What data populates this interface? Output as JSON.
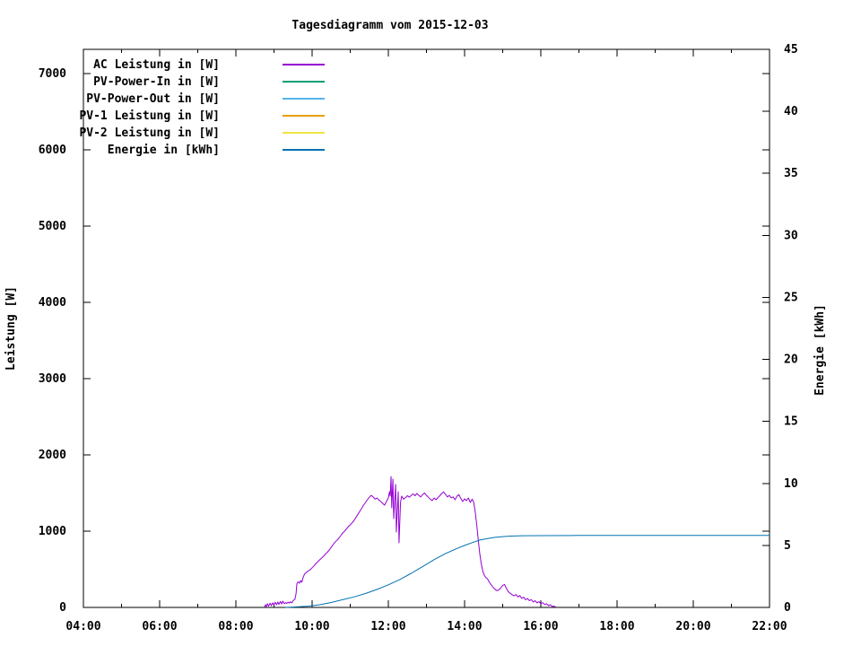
{
  "chart_data": {
    "type": "line",
    "title": "Tagesdiagramm vom 2015-12-03",
    "background_color": "#ffffff",
    "foreground_color": "#000000",
    "grid": false,
    "legend_position": "top-left-inside",
    "x_axis": {
      "unit": "time",
      "min_hour": 4,
      "max_hour": 22,
      "major_ticks": [
        {
          "hour": 4,
          "label": "04:00"
        },
        {
          "hour": 6,
          "label": "06:00"
        },
        {
          "hour": 8,
          "label": "08:00"
        },
        {
          "hour": 10,
          "label": "10:00"
        },
        {
          "hour": 12,
          "label": "12:00"
        },
        {
          "hour": 14,
          "label": "14:00"
        },
        {
          "hour": 16,
          "label": "16:00"
        },
        {
          "hour": 18,
          "label": "18:00"
        },
        {
          "hour": 20,
          "label": "20:00"
        },
        {
          "hour": 22,
          "label": "22:00"
        }
      ],
      "minor_tick_hours": [
        5,
        7,
        9,
        11,
        13,
        15,
        17,
        19,
        21
      ]
    },
    "y_axis_left": {
      "title": "Leistung [W]",
      "min": 0,
      "max": 7318,
      "tick_values": [
        0,
        1000,
        2000,
        3000,
        4000,
        5000,
        6000,
        7000
      ],
      "tick_labels": [
        "0",
        "1000",
        "2000",
        "3000",
        "4000",
        "5000",
        "6000",
        "7000"
      ]
    },
    "y_axis_right": {
      "title": "Energie [kWh]",
      "min": 0,
      "max": 45,
      "tick_values": [
        0,
        5,
        10,
        15,
        20,
        25,
        30,
        35,
        40,
        45
      ],
      "tick_labels": [
        "0",
        "5",
        "10",
        "15",
        "20",
        "25",
        "30",
        "35",
        "40",
        "45"
      ]
    },
    "series": [
      {
        "name": "AC Leistung in [W]",
        "color": "#9400d3",
        "axis": "left",
        "points": [
          [
            8.75,
            5
          ],
          [
            8.78,
            35
          ],
          [
            8.8,
            12
          ],
          [
            8.83,
            48
          ],
          [
            8.86,
            18
          ],
          [
            8.9,
            55
          ],
          [
            8.93,
            22
          ],
          [
            8.97,
            60
          ],
          [
            9.0,
            30
          ],
          [
            9.03,
            68
          ],
          [
            9.07,
            35
          ],
          [
            9.1,
            72
          ],
          [
            9.13,
            40
          ],
          [
            9.17,
            78
          ],
          [
            9.2,
            45
          ],
          [
            9.23,
            82
          ],
          [
            9.27,
            50
          ],
          [
            9.3,
            62
          ],
          [
            9.33,
            52
          ],
          [
            9.37,
            70
          ],
          [
            9.4,
            55
          ],
          [
            9.43,
            75
          ],
          [
            9.47,
            60
          ],
          [
            9.5,
            88
          ],
          [
            9.55,
            110
          ],
          [
            9.58,
            180
          ],
          [
            9.6,
            310
          ],
          [
            9.63,
            335
          ],
          [
            9.67,
            318
          ],
          [
            9.7,
            353
          ],
          [
            9.73,
            330
          ],
          [
            9.77,
            400
          ],
          [
            9.8,
            435
          ],
          [
            9.85,
            460
          ],
          [
            9.9,
            480
          ],
          [
            9.95,
            494
          ],
          [
            10.0,
            520
          ],
          [
            10.05,
            545
          ],
          [
            10.1,
            576
          ],
          [
            10.15,
            600
          ],
          [
            10.2,
            625
          ],
          [
            10.25,
            647
          ],
          [
            10.3,
            672
          ],
          [
            10.35,
            700
          ],
          [
            10.4,
            724
          ],
          [
            10.45,
            753
          ],
          [
            10.5,
            790
          ],
          [
            10.55,
            824
          ],
          [
            10.6,
            855
          ],
          [
            10.65,
            880
          ],
          [
            10.7,
            906
          ],
          [
            10.75,
            941
          ],
          [
            10.8,
            975
          ],
          [
            10.85,
            1000
          ],
          [
            10.9,
            1030
          ],
          [
            10.95,
            1060
          ],
          [
            11.0,
            1082
          ],
          [
            11.05,
            1110
          ],
          [
            11.1,
            1141
          ],
          [
            11.15,
            1180
          ],
          [
            11.2,
            1220
          ],
          [
            11.25,
            1259
          ],
          [
            11.3,
            1300
          ],
          [
            11.35,
            1341
          ],
          [
            11.4,
            1376
          ],
          [
            11.45,
            1412
          ],
          [
            11.5,
            1445
          ],
          [
            11.55,
            1470
          ],
          [
            11.6,
            1450
          ],
          [
            11.65,
            1420
          ],
          [
            11.7,
            1435
          ],
          [
            11.75,
            1410
          ],
          [
            11.8,
            1390
          ],
          [
            11.85,
            1365
          ],
          [
            11.9,
            1341
          ],
          [
            11.95,
            1390
          ],
          [
            12.0,
            1435
          ],
          [
            12.03,
            1518
          ],
          [
            12.05,
            1460
          ],
          [
            12.07,
            1717
          ],
          [
            12.09,
            1306
          ],
          [
            12.12,
            1682
          ],
          [
            12.14,
            1165
          ],
          [
            12.19,
            1612
          ],
          [
            12.21,
            988
          ],
          [
            12.26,
            1518
          ],
          [
            12.28,
            847
          ],
          [
            12.32,
            1380
          ],
          [
            12.35,
            1459
          ],
          [
            12.4,
            1420
          ],
          [
            12.45,
            1440
          ],
          [
            12.5,
            1465
          ],
          [
            12.55,
            1445
          ],
          [
            12.6,
            1470
          ],
          [
            12.65,
            1488
          ],
          [
            12.7,
            1465
          ],
          [
            12.75,
            1494
          ],
          [
            12.8,
            1470
          ],
          [
            12.85,
            1450
          ],
          [
            12.9,
            1480
          ],
          [
            12.95,
            1500
          ],
          [
            13.0,
            1470
          ],
          [
            13.05,
            1445
          ],
          [
            13.1,
            1420
          ],
          [
            13.15,
            1400
          ],
          [
            13.2,
            1435
          ],
          [
            13.25,
            1412
          ],
          [
            13.3,
            1440
          ],
          [
            13.35,
            1465
          ],
          [
            13.4,
            1494
          ],
          [
            13.45,
            1515
          ],
          [
            13.5,
            1480
          ],
          [
            13.55,
            1450
          ],
          [
            13.6,
            1470
          ],
          [
            13.65,
            1435
          ],
          [
            13.7,
            1450
          ],
          [
            13.75,
            1412
          ],
          [
            13.8,
            1459
          ],
          [
            13.85,
            1480
          ],
          [
            13.9,
            1430
          ],
          [
            13.95,
            1388
          ],
          [
            14.0,
            1424
          ],
          [
            14.05,
            1400
          ],
          [
            14.1,
            1435
          ],
          [
            14.15,
            1376
          ],
          [
            14.2,
            1420
          ],
          [
            14.24,
            1376
          ],
          [
            14.28,
            1250
          ],
          [
            14.32,
            1080
          ],
          [
            14.36,
            880
          ],
          [
            14.4,
            700
          ],
          [
            14.44,
            566
          ],
          [
            14.48,
            470
          ],
          [
            14.52,
            420
          ],
          [
            14.56,
            390
          ],
          [
            14.6,
            376
          ],
          [
            14.65,
            330
          ],
          [
            14.7,
            295
          ],
          [
            14.75,
            260
          ],
          [
            14.8,
            238
          ],
          [
            14.85,
            220
          ],
          [
            14.9,
            230
          ],
          [
            14.95,
            258
          ],
          [
            15.0,
            290
          ],
          [
            15.05,
            300
          ],
          [
            15.1,
            245
          ],
          [
            15.15,
            205
          ],
          [
            15.2,
            185
          ],
          [
            15.25,
            165
          ],
          [
            15.3,
            152
          ],
          [
            15.35,
            170
          ],
          [
            15.4,
            138
          ],
          [
            15.45,
            155
          ],
          [
            15.5,
            118
          ],
          [
            15.55,
            135
          ],
          [
            15.6,
            100
          ],
          [
            15.65,
            118
          ],
          [
            15.7,
            88
          ],
          [
            15.75,
            102
          ],
          [
            15.8,
            72
          ],
          [
            15.85,
            88
          ],
          [
            15.9,
            60
          ],
          [
            15.95,
            75
          ],
          [
            16.0,
            50
          ],
          [
            16.05,
            62
          ],
          [
            16.1,
            38
          ],
          [
            16.15,
            50
          ],
          [
            16.2,
            24
          ],
          [
            16.25,
            35
          ],
          [
            16.3,
            12
          ],
          [
            16.35,
            18
          ],
          [
            16.4,
            2
          ]
        ]
      },
      {
        "name": "PV-Power-In in [W]",
        "color": "#009e73",
        "axis": "left",
        "points": []
      },
      {
        "name": "PV-Power-Out in [W]",
        "color": "#56b4e9",
        "axis": "left",
        "points": []
      },
      {
        "name": "PV-1 Leistung in [W]",
        "color": "#e69f00",
        "axis": "left",
        "points": []
      },
      {
        "name": "PV-2 Leistung in [W]",
        "color": "#f0e442",
        "axis": "left",
        "points": []
      },
      {
        "name": "Energie in [kWh]",
        "color": "#0072b2",
        "axis": "right",
        "points": [
          [
            9.3,
            0
          ],
          [
            9.6,
            0.04
          ],
          [
            9.9,
            0.1
          ],
          [
            10.2,
            0.22
          ],
          [
            10.5,
            0.4
          ],
          [
            10.8,
            0.62
          ],
          [
            11.1,
            0.85
          ],
          [
            11.4,
            1.12
          ],
          [
            11.7,
            1.45
          ],
          [
            12.0,
            1.82
          ],
          [
            12.3,
            2.25
          ],
          [
            12.6,
            2.75
          ],
          [
            12.9,
            3.3
          ],
          [
            13.2,
            3.85
          ],
          [
            13.5,
            4.35
          ],
          [
            13.8,
            4.75
          ],
          [
            14.0,
            5.0
          ],
          [
            14.2,
            5.22
          ],
          [
            14.4,
            5.43
          ],
          [
            14.6,
            5.55
          ],
          [
            14.8,
            5.65
          ],
          [
            15.0,
            5.71
          ],
          [
            15.2,
            5.75
          ],
          [
            15.5,
            5.78
          ],
          [
            16.0,
            5.79
          ],
          [
            17.0,
            5.8
          ],
          [
            22.0,
            5.8
          ]
        ]
      }
    ]
  }
}
